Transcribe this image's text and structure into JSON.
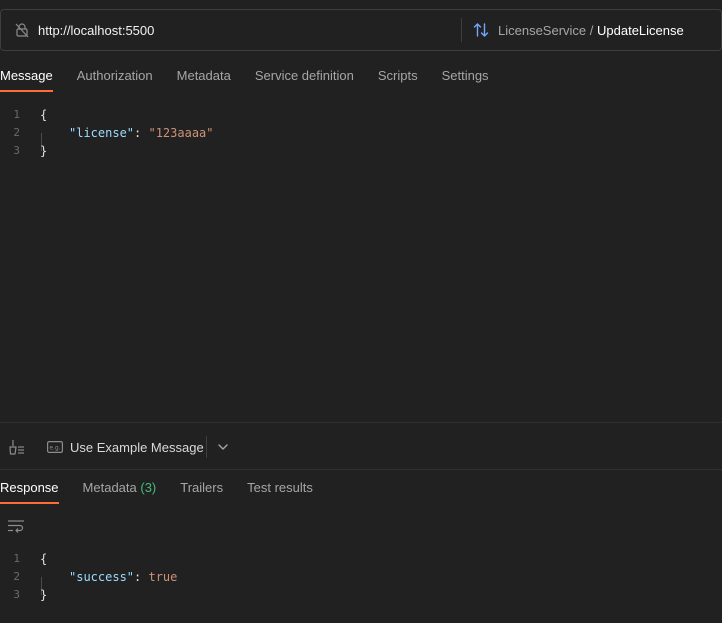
{
  "url_bar": {
    "url": "http://localhost:5500",
    "service": "LicenseService",
    "separator": " / ",
    "method": "UpdateLicense"
  },
  "request_tabs": [
    {
      "label": "Message",
      "active": true
    },
    {
      "label": "Authorization",
      "active": false
    },
    {
      "label": "Metadata",
      "active": false
    },
    {
      "label": "Service definition",
      "active": false
    },
    {
      "label": "Scripts",
      "active": false
    },
    {
      "label": "Settings",
      "active": false
    }
  ],
  "message_editor": {
    "line_numbers": [
      "1",
      "2",
      "3"
    ],
    "open_brace": "{",
    "key": "\"license\"",
    "colon": ": ",
    "value": "\"123aaaa\"",
    "close_brace": "}"
  },
  "toolbar": {
    "example_label": "Use Example Message"
  },
  "response_tabs": [
    {
      "label": "Response",
      "active": true
    },
    {
      "label": "Metadata",
      "count": "(3)",
      "active": false
    },
    {
      "label": "Trailers",
      "active": false
    },
    {
      "label": "Test results",
      "active": false
    }
  ],
  "response_editor": {
    "line_numbers": [
      "1",
      "2",
      "3"
    ],
    "open_brace": "{",
    "key": "\"success\"",
    "colon": ": ",
    "value": "true",
    "close_brace": "}"
  },
  "colors": {
    "accent": "#ff6c37",
    "count_green": "#48b97e",
    "json_key": "#9cdcfe",
    "json_value": "#ce9178",
    "background": "#212121"
  }
}
